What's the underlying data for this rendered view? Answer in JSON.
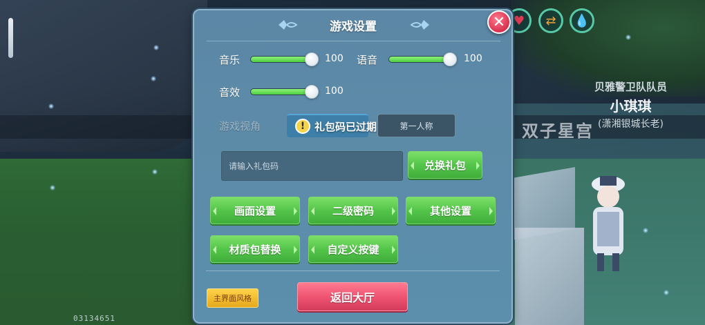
{
  "dialog": {
    "title": "游戏设置",
    "close_symbol": "✕"
  },
  "audio": {
    "music_label": "音乐",
    "music_value": "100",
    "music_level": 1.0,
    "voice_label": "语音",
    "voice_value": "100",
    "voice_level": 1.0,
    "sfx_label": "音效",
    "sfx_value": "100",
    "sfx_level": 1.0
  },
  "view": {
    "label": "游戏视角",
    "first_person": "第一人称"
  },
  "toast": {
    "icon_symbol": "!",
    "message": "礼包码已过期"
  },
  "gift": {
    "placeholder": "请输入礼包码",
    "redeem_label": "兑换礼包"
  },
  "buttons": {
    "graphics": "画面设置",
    "secondary_password": "二级密码",
    "other_settings": "其他设置",
    "texture_pack": "材质包替换",
    "custom_keys": "自定义按键"
  },
  "footer": {
    "ui_style": "主界面风格",
    "return_lobby": "返回大厅"
  },
  "scene": {
    "npc_role": "贝雅警卫队队员",
    "npc_name": "小琪琪",
    "npc_title": "(潇湘银城长老)",
    "area_name": "双子星宫",
    "uid": "03134651"
  },
  "hud": {
    "icons": [
      "heart-icon",
      "swap-icon",
      "drop-icon"
    ]
  },
  "colors": {
    "accent_green": "#54c54a",
    "accent_red": "#ef5471",
    "panel": "#5c8ba8"
  }
}
